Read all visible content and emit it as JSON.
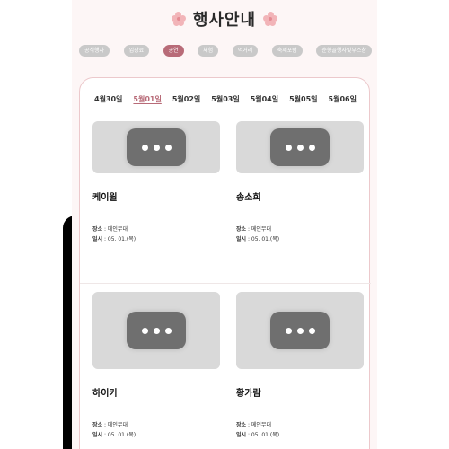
{
  "header": {
    "title": "행사안내"
  },
  "categories": [
    {
      "label": "공식행사",
      "active": false
    },
    {
      "label": "입장료",
      "active": false
    },
    {
      "label": "공연",
      "active": true
    },
    {
      "label": "체험",
      "active": false
    },
    {
      "label": "먹거리",
      "active": false
    },
    {
      "label": "축제포럼",
      "active": false
    },
    {
      "label": "춘향골행사및부스참",
      "active": false
    }
  ],
  "dates": [
    {
      "label": "4월30일",
      "active": false
    },
    {
      "label": "5월01일",
      "active": true
    },
    {
      "label": "5월02일",
      "active": false
    },
    {
      "label": "5월03일",
      "active": false
    },
    {
      "label": "5월04일",
      "active": false
    },
    {
      "label": "5월05일",
      "active": false
    },
    {
      "label": "5월06일",
      "active": false
    }
  ],
  "events": [
    {
      "name": "케이윌",
      "place_label": "장소",
      "place": "메인무대",
      "date_label": "일시",
      "date": "05. 01.(목)"
    },
    {
      "name": "송소희",
      "place_label": "장소",
      "place": "메인무대",
      "date_label": "일시",
      "date": "05. 01.(목)"
    },
    {
      "name": "하이키",
      "place_label": "장소",
      "place": "메인무대",
      "date_label": "일시",
      "date": "05. 01.(목)"
    },
    {
      "name": "황가람",
      "place_label": "장소",
      "place": "메인무대",
      "date_label": "일시",
      "date": "05. 01.(목)"
    }
  ],
  "icons": {
    "title_decor": "flower-icon",
    "thumb": "chat-bubble-icon"
  },
  "colors": {
    "accent": "#b86b78",
    "chip": "#c9c9c9",
    "thumb": "#d9d9d9",
    "bubble": "#6f6f6f"
  }
}
